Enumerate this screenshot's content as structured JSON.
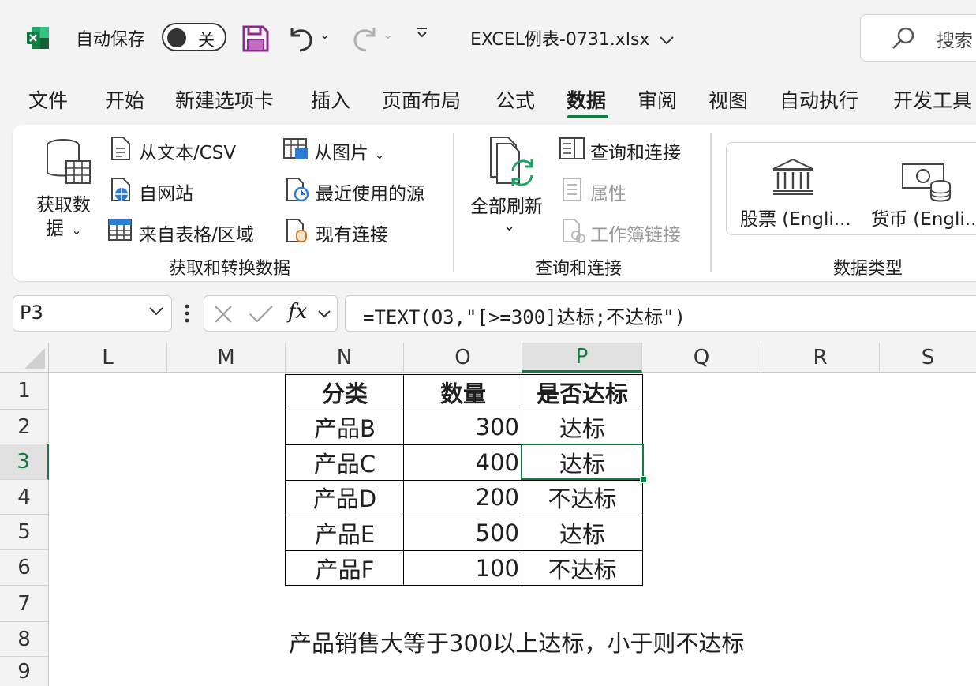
{
  "titlebar": {
    "autosave_label": "自动保存",
    "autosave_state": "关",
    "filename": "EXCEL例表-0731.xlsx",
    "search_placeholder": "搜索"
  },
  "tabs": [
    "文件",
    "开始",
    "新建选项卡",
    "插入",
    "页面布局",
    "公式",
    "数据",
    "审阅",
    "视图",
    "自动执行",
    "开发工具"
  ],
  "active_tab": "数据",
  "ribbon": {
    "get_data": [
      "获取数",
      "据"
    ],
    "from_text_csv": "从文本/CSV",
    "from_web": "自网站",
    "from_table": "来自表格/区域",
    "from_picture": "从图片",
    "recent_sources": "最近使用的源",
    "existing_connections": "现有连接",
    "group_get_transform": "获取和转换数据",
    "refresh_all": "全部刷新",
    "queries_connections": "查询和连接",
    "properties": "属性",
    "workbook_links": "工作簿链接",
    "group_queries": "查询和连接",
    "stocks": "股票 (Engli...",
    "currencies": "货币 (Engli...",
    "group_data_types": "数据类型"
  },
  "formula_bar": {
    "name_box": "P3",
    "formula": "=TEXT(O3,\"[>=300]达标;不达标\")"
  },
  "sheet": {
    "columns": [
      "L",
      "M",
      "N",
      "O",
      "P",
      "Q",
      "R",
      "S"
    ],
    "selected_column": "P",
    "rows": [
      "1",
      "2",
      "3",
      "4",
      "5",
      "6",
      "7",
      "8",
      "9"
    ],
    "selected_row": "3",
    "table_headers": [
      "分类",
      "数量",
      "是否达标"
    ],
    "table_rows": [
      [
        "产品B",
        "300",
        "达标"
      ],
      [
        "产品C",
        "400",
        "达标"
      ],
      [
        "产品D",
        "200",
        "不达标"
      ],
      [
        "产品E",
        "500",
        "达标"
      ],
      [
        "产品F",
        "100",
        "不达标"
      ]
    ],
    "note": "产品销售大等于300以上达标，小于则不达标"
  }
}
